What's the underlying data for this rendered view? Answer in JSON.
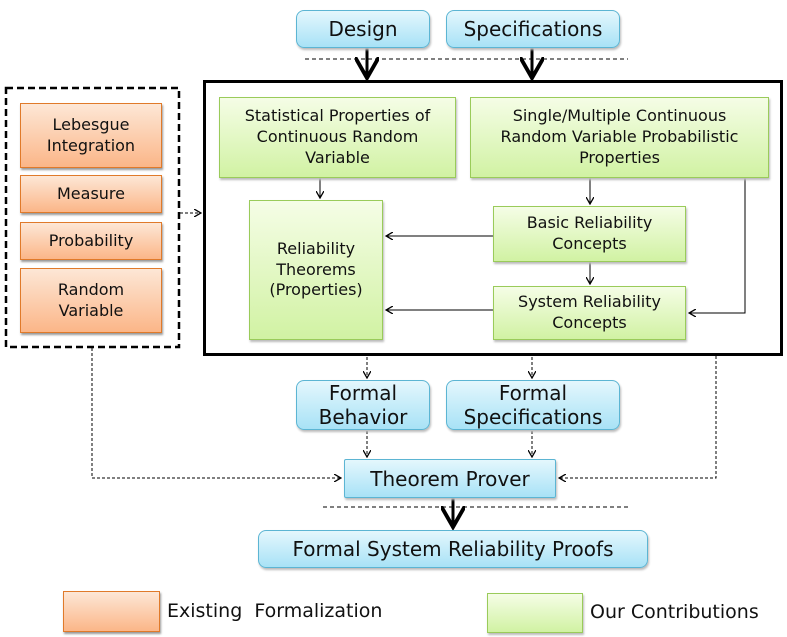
{
  "inputs": {
    "design": "Design",
    "specifications": "Specifications"
  },
  "existing": [
    "Lebesgue Integration",
    "Measure",
    "Probability",
    "Random Variable"
  ],
  "contributions": {
    "statistical": "Statistical Properties of Continuous Random Variable",
    "single_multiple": "Single/Multiple Continuous Random Variable Probabilistic Properties",
    "theorems": "Reliability Theorems (Properties)",
    "basic": "Basic Reliability Concepts",
    "system": "System Reliability Concepts"
  },
  "formal": {
    "behavior": "Formal Behavior",
    "specifications": "Formal Specifications"
  },
  "prover": "Theorem Prover",
  "output": "Formal System Reliability Proofs",
  "legend": {
    "existing": "Existing  Formalization",
    "ours": "Our Contributions"
  },
  "colors": {
    "existing": "#fbb688",
    "ours": "#d1f2a3",
    "io": "#a8e2f6"
  }
}
